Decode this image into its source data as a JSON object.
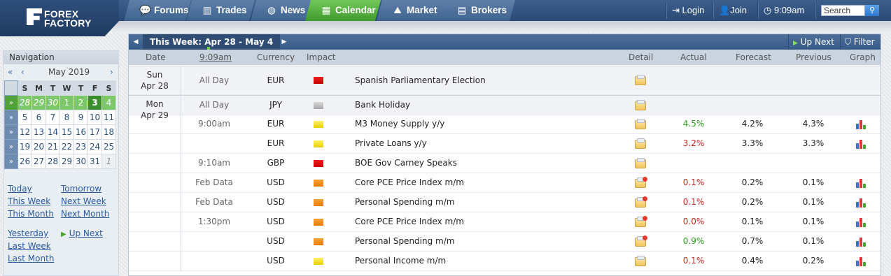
{
  "header": {
    "logo_line1": "FOREX",
    "logo_line2": "FACTORY",
    "tabs": [
      {
        "label": "Forums",
        "icon": "speech-bubbles-icon"
      },
      {
        "label": "Trades",
        "icon": "bar-chart-icon"
      },
      {
        "label": "News",
        "icon": "globe-icon"
      },
      {
        "label": "Calendar",
        "icon": "calendar-icon",
        "active": true
      },
      {
        "label": "Market",
        "icon": "line-chart-icon"
      },
      {
        "label": "Brokers",
        "icon": "building-icon"
      }
    ],
    "login_label": "Login",
    "join_label": "Join",
    "time": "9:09am",
    "search_placeholder": "Search"
  },
  "navigation": {
    "title": "Navigation",
    "prev_year": "«",
    "prev_month": "‹",
    "month": "May 2019",
    "next_month": "›",
    "weekday_headers": [
      "S",
      "M",
      "T",
      "W",
      "T",
      "F",
      "S"
    ],
    "weeks": [
      [
        "28",
        "29",
        "30",
        "1",
        "2",
        "3",
        "4"
      ],
      [
        "5",
        "6",
        "7",
        "8",
        "9",
        "10",
        "11"
      ],
      [
        "12",
        "13",
        "14",
        "15",
        "16",
        "17",
        "18"
      ],
      [
        "19",
        "20",
        "21",
        "22",
        "23",
        "24",
        "25"
      ],
      [
        "26",
        "27",
        "28",
        "29",
        "30",
        "31",
        "1"
      ]
    ],
    "week_marker": "»",
    "links": {
      "today": "Today",
      "tomorrow": "Tomorrow",
      "this_week": "This Week",
      "next_week": "Next Week",
      "this_month": "This Month",
      "next_month": "Next Month",
      "yesterday": "Yesterday",
      "up_next": "Up Next",
      "last_week": "Last Week",
      "last_month": "Last Month"
    }
  },
  "calendar": {
    "week_title": "This Week: Apr 28 - May 4",
    "up_next_label": "Up Next",
    "filter_label": "Filter",
    "columns": {
      "date": "Date",
      "time": "9:09am",
      "currency": "Currency",
      "impact": "Impact",
      "detail": "Detail",
      "actual": "Actual",
      "forecast": "Forecast",
      "previous": "Previous",
      "graph": "Graph"
    },
    "days": [
      {
        "dow": "Sun",
        "date": "Apr 28"
      },
      {
        "dow": "Mon",
        "date": "Apr 29"
      }
    ],
    "events": [
      {
        "day": 0,
        "time": "All Day",
        "currency": "EUR",
        "impact": "high",
        "event": "Spanish Parliamentary Election",
        "detail_icon": "folder-icon",
        "actual": "",
        "forecast": "",
        "previous": "",
        "graph": false
      },
      {
        "day": 1,
        "time": "All Day",
        "currency": "JPY",
        "impact": "holiday",
        "event": "Bank Holiday",
        "detail_icon": "folder-icon",
        "actual": "",
        "forecast": "",
        "previous": "",
        "graph": false
      },
      {
        "day": 1,
        "time": "9:00am",
        "currency": "EUR",
        "impact": "low",
        "event": "M3 Money Supply y/y",
        "detail_icon": "folder-icon",
        "actual": "4.5%",
        "actual_color": "green",
        "forecast": "4.2%",
        "previous": "4.3%",
        "graph": true
      },
      {
        "day": 1,
        "time": "",
        "currency": "EUR",
        "impact": "low",
        "event": "Private Loans y/y",
        "detail_icon": "folder-icon",
        "actual": "3.2%",
        "actual_color": "red",
        "forecast": "3.3%",
        "previous": "3.3%",
        "graph": true
      },
      {
        "day": 1,
        "time": "9:10am",
        "currency": "GBP",
        "impact": "high",
        "event": "BOE Gov Carney Speaks",
        "detail_icon": "folder-icon",
        "actual": "",
        "forecast": "",
        "previous": "",
        "graph": false
      },
      {
        "day": 1,
        "time": "Feb Data",
        "currency": "USD",
        "impact": "medium",
        "event": "Core PCE Price Index m/m",
        "detail_icon": "folder-alert-icon",
        "actual": "0.1%",
        "actual_color": "red",
        "forecast": "0.2%",
        "previous": "0.1%",
        "graph": true
      },
      {
        "day": 1,
        "time": "Feb Data",
        "currency": "USD",
        "impact": "medium",
        "event": "Personal Spending m/m",
        "detail_icon": "folder-alert-icon",
        "actual": "0.1%",
        "actual_color": "red",
        "forecast": "0.2%",
        "previous": "0.1%",
        "graph": true
      },
      {
        "day": 1,
        "time": "1:30pm",
        "currency": "USD",
        "impact": "medium",
        "event": "Core PCE Price Index m/m",
        "detail_icon": "folder-alert-icon",
        "actual": "0.0%",
        "actual_color": "red",
        "forecast": "0.1%",
        "previous": "0.1%",
        "graph": true
      },
      {
        "day": 1,
        "time": "",
        "currency": "USD",
        "impact": "medium",
        "event": "Personal Spending m/m",
        "detail_icon": "folder-alert-icon",
        "actual": "0.9%",
        "actual_color": "green",
        "forecast": "0.7%",
        "previous": "0.1%",
        "graph": true
      },
      {
        "day": 1,
        "time": "",
        "currency": "USD",
        "impact": "low",
        "event": "Personal Income m/m",
        "detail_icon": "folder-icon",
        "actual": "0.1%",
        "actual_color": "red",
        "forecast": "0.4%",
        "previous": "0.2%",
        "graph": true
      }
    ]
  }
}
